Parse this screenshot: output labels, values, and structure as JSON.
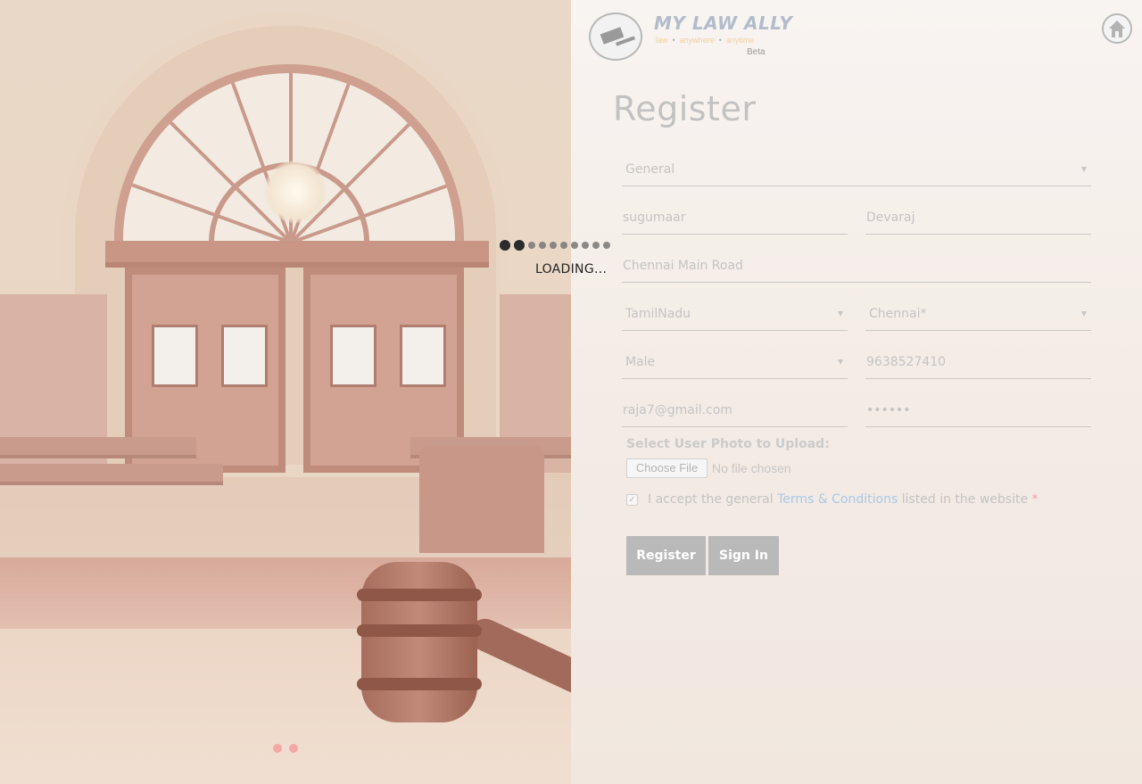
{
  "brand": {
    "title": "MY LAW ALLY",
    "tagline": [
      "law",
      "anywhere",
      "anytime"
    ],
    "beta": "Beta"
  },
  "page": {
    "title": "Register"
  },
  "form": {
    "category": {
      "value": "General"
    },
    "first_name": {
      "value": "sugumaar"
    },
    "last_name": {
      "value": "Devaraj"
    },
    "address": {
      "value": "Chennai Main Road"
    },
    "state": {
      "value": "TamilNadu"
    },
    "city": {
      "value": "Chennai*"
    },
    "gender": {
      "value": "Male"
    },
    "phone": {
      "value": "9638527410"
    },
    "email": {
      "value": "raja7@gmail.com"
    },
    "password": {
      "value": "••••••"
    },
    "upload": {
      "label": "Select User Photo to Upload:",
      "button": "Choose File",
      "status": "No file chosen"
    },
    "terms": {
      "checked": true,
      "prefix": "I accept the general",
      "link": "Terms & Conditions",
      "suffix": "listed in the website",
      "required_mark": "*"
    },
    "register_button": "Register",
    "signin_button": "Sign In"
  },
  "loading": {
    "text": "LOADING..."
  },
  "icons": {
    "home": "home-icon",
    "logo": "gavel-book-emblem-icon",
    "checkbox": "checkmark-icon"
  },
  "colors": {
    "accent_link": "#a9c8e6",
    "required": "#f3a0a0",
    "button_bg": "#b9b9b9",
    "carousel_dot": "#f4a7a7"
  }
}
